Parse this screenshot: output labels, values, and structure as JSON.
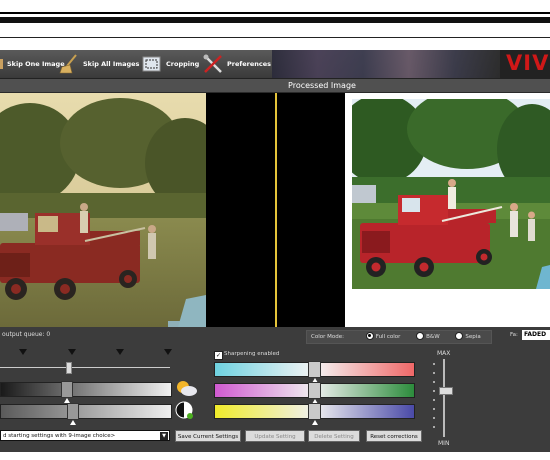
{
  "toolbar": {
    "skip_one": "Skip One Image",
    "skip_all": "Skip All Images",
    "cropping": "Cropping",
    "preferences": "Preferences",
    "logo": "VIV"
  },
  "header": {
    "title": "Processed Image"
  },
  "controls": {
    "queue_text": "output queue: 0",
    "sharpening_label": "Sharpening enabled",
    "sharpening_checked": true,
    "preset_value": "d starting settings with 9-image choice>",
    "buttons": {
      "save": "Save Current Settings",
      "update": "Update Setting",
      "delete": "Delete Setting",
      "reset": "Reset corrections"
    },
    "color_mode": {
      "label": "Color Mode:",
      "options": [
        "Full color",
        "B&W",
        "Sepia"
      ],
      "selected": "Full color"
    },
    "fade": {
      "label": "Fa:",
      "value": "FADED"
    },
    "scale": {
      "max": "MAX",
      "min": "MIN"
    }
  },
  "colors": {
    "accent_divider": "#e5c43a",
    "logo_red": "#d01818"
  }
}
